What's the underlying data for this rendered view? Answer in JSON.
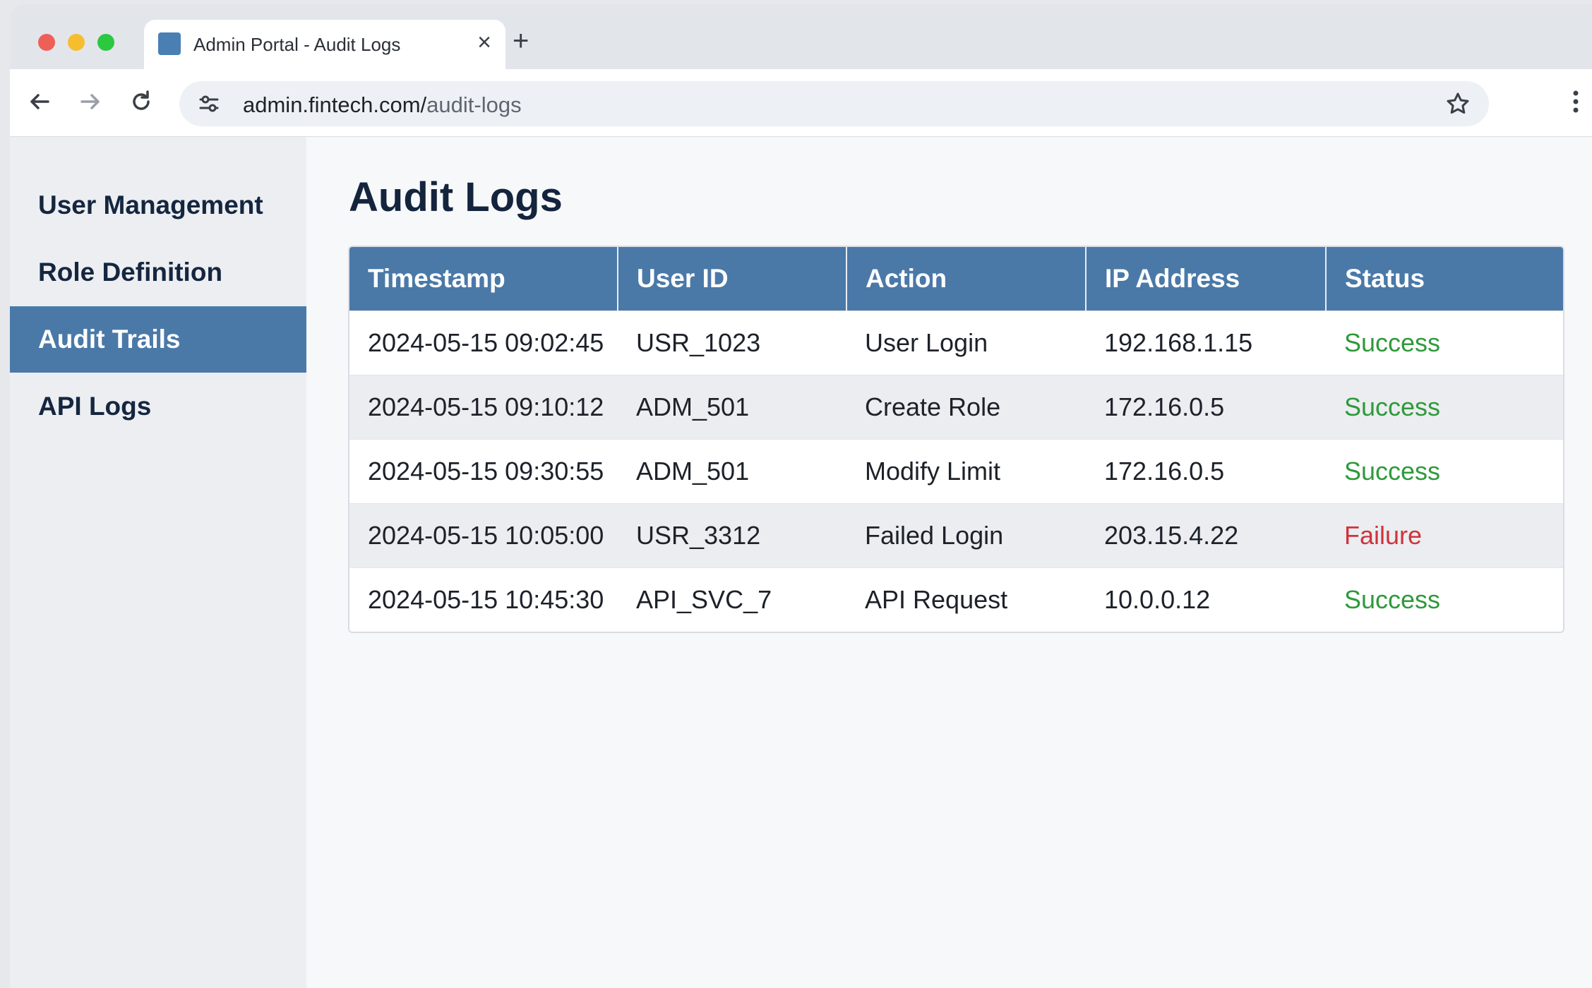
{
  "browser": {
    "tab_title": "Admin Portal - Audit Logs",
    "tab_close": "×",
    "new_tab": "+",
    "url_domain": "admin.fintech.com/",
    "url_path": "audit-logs"
  },
  "sidebar": {
    "items": [
      {
        "label": "User Management",
        "active": false
      },
      {
        "label": "Role Definition",
        "active": false
      },
      {
        "label": "Audit Trails",
        "active": true
      },
      {
        "label": "API Logs",
        "active": false
      }
    ]
  },
  "main": {
    "title": "Audit Logs",
    "table": {
      "columns": [
        "Timestamp",
        "User ID",
        "Action",
        "IP Address",
        "Status"
      ],
      "rows": [
        [
          "2024-05-15 09:02:45",
          "USR_1023",
          "User Login",
          "192.168.1.15",
          "Success"
        ],
        [
          "2024-05-15 09:10:12",
          "ADM_501",
          "Create Role",
          "172.16.0.5",
          "Success"
        ],
        [
          "2024-05-15 09:30:55",
          "ADM_501",
          "Modify Limit",
          "172.16.0.5",
          "Success"
        ],
        [
          "2024-05-15 10:05:00",
          "USR_3312",
          "Failed Login",
          "203.15.4.22",
          "Failure"
        ],
        [
          "2024-05-15 10:45:30",
          "API_SVC_7",
          "API Request",
          "10.0.0.12",
          "Success"
        ]
      ]
    }
  },
  "colors": {
    "accent": "#4a79a8",
    "success": "#2e9a3a",
    "failure": "#d0333b"
  }
}
